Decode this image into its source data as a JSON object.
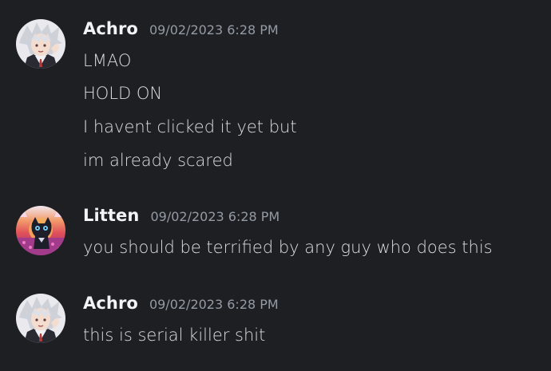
{
  "messages": [
    {
      "username": "Achro",
      "timestamp": "09/02/2023 6:28 PM",
      "avatar_icon": "white-haired-anime-character-avatar",
      "lines": [
        "LMAO",
        "HOLD ON",
        "I havent clicked it yet but",
        "im already scared"
      ]
    },
    {
      "username": "Litten",
      "timestamp": "09/02/2023 6:28 PM",
      "avatar_icon": "black-cat-sunset-avatar",
      "lines": [
        "you should be terrified by any guy who does this"
      ]
    },
    {
      "username": "Achro",
      "timestamp": "09/02/2023 6:28 PM",
      "avatar_icon": "white-haired-anime-character-avatar",
      "lines": [
        "this is serial killer shit"
      ]
    }
  ],
  "colors": {
    "background": "#1e1f22",
    "username": "#f2f3f5",
    "timestamp": "#949ba4",
    "message_text": "#dbdee1"
  }
}
